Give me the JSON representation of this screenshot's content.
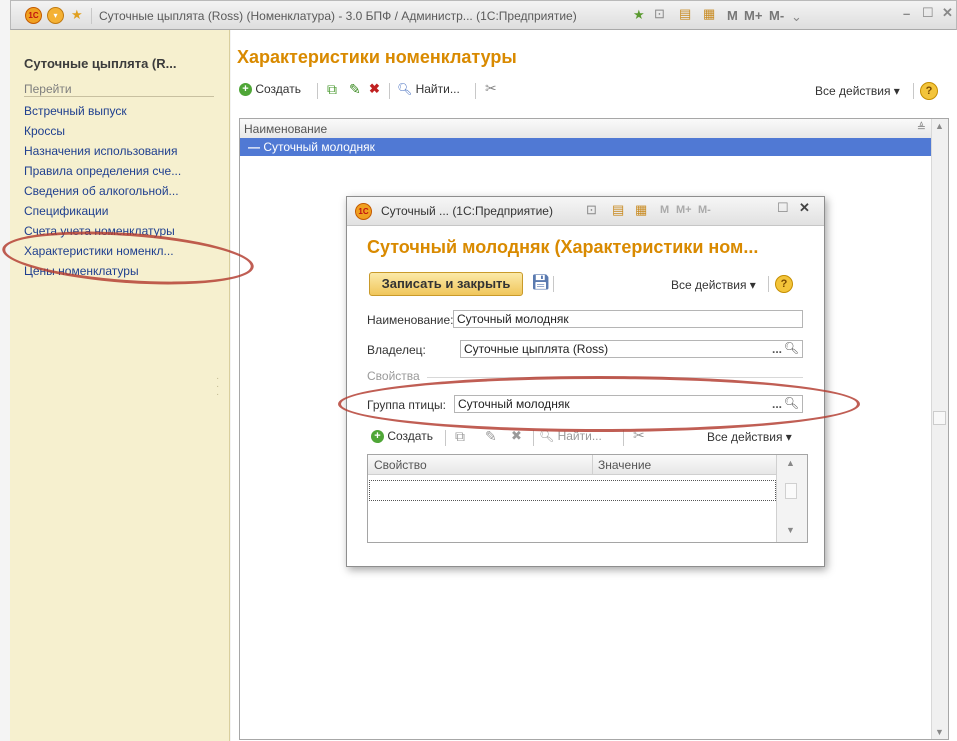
{
  "window": {
    "title": "Суточные цыплята (Ross) (Номенклатура) - 3.0 БПФ / Администр... (1С:Предприятие)",
    "m_labels": [
      "M",
      "M+",
      "M-"
    ]
  },
  "sidebar": {
    "title": "Суточные цыплята (R...",
    "section": "Перейти",
    "items": [
      {
        "label": "Встречный выпуск"
      },
      {
        "label": "Кроссы"
      },
      {
        "label": "Назначения использования"
      },
      {
        "label": "Правила определения сче..."
      },
      {
        "label": "Сведения об алкогольной..."
      },
      {
        "label": "Спецификации"
      },
      {
        "label": "Счета учета номенклатуры"
      },
      {
        "label": "Характеристики номенкл..."
      },
      {
        "label": "Цены номенклатуры"
      }
    ]
  },
  "main": {
    "title": "Характеристики номенклатуры",
    "toolbar": {
      "create": "Создать",
      "find": "Найти...",
      "all_actions": "Все действия ▾"
    },
    "list": {
      "column": "Наименование",
      "rows": [
        {
          "name": "Суточный молодняк",
          "prefix": "—"
        }
      ]
    }
  },
  "dialog": {
    "window_title": "Суточный ... (1С:Предприятие)",
    "heading": "Суточный молодняк (Характеристики ном...",
    "save_close": "Записать и закрыть",
    "all_actions": "Все действия ▾",
    "fields": {
      "name_label": "Наименование:",
      "name_value": "Суточный молодняк",
      "owner_label": "Владелец:",
      "owner_value": "Суточные цыплята (Ross)",
      "props_label": "Свойства",
      "group_label": "Группа птицы:",
      "group_value": "Суточный молодняк"
    },
    "toolbar": {
      "create": "Создать",
      "find": "Найти...",
      "all_actions": "Все действия ▾"
    },
    "table": {
      "columns": [
        "Свойство",
        "Значение"
      ]
    }
  },
  "icons": {
    "logo": "1c-logo",
    "help": "?",
    "ellipsis": "...",
    "search": "Q"
  },
  "colors": {
    "accent_orange": "#d98a00",
    "selection_blue": "#5079d4",
    "sidebar_bg": "#f6f0cf",
    "annotation_red": "#b23a2e"
  }
}
